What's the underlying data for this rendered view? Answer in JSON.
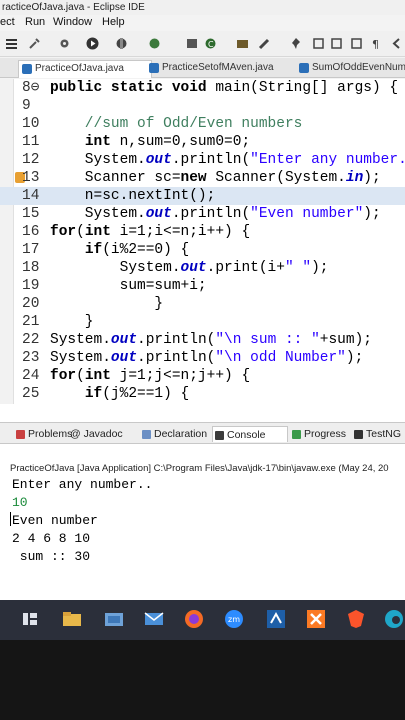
{
  "window": {
    "title": "racticeOfJava.java - Eclipse IDE"
  },
  "menu": [
    "ect",
    "Run",
    "Window",
    "Help"
  ],
  "tabs": [
    {
      "label": "PracticeOfJava.java",
      "active": true
    },
    {
      "label": "PracticeSetofMAven.java",
      "active": false
    },
    {
      "label": "SumOfOddEvenNum",
      "active": false
    }
  ],
  "editor": {
    "lines": [
      {
        "num": "8⊖",
        "code": "public static void main(String[] args) {"
      },
      {
        "num": "9",
        "code": ""
      },
      {
        "num": "10",
        "code": "    //sum of Odd/Even numbers"
      },
      {
        "num": "11",
        "code": "    int n,sum=0,sum0=0;"
      },
      {
        "num": "12",
        "code": "    System.out.println(\"Enter any number..\");"
      },
      {
        "num": "13",
        "code": "    Scanner sc=new Scanner(System.in);"
      },
      {
        "num": "14",
        "code": "    n=sc.nextInt();"
      },
      {
        "num": "15",
        "code": "    System.out.println(\"Even number\");"
      },
      {
        "num": "16",
        "code": "for(int i=1;i<=n;i++) {"
      },
      {
        "num": "17",
        "code": "    if(i%2==0) {"
      },
      {
        "num": "18",
        "code": "        System.out.print(i+\" \");"
      },
      {
        "num": "19",
        "code": "        sum=sum+i;"
      },
      {
        "num": "20",
        "code": "            }"
      },
      {
        "num": "21",
        "code": "    }"
      },
      {
        "num": "22",
        "code": "System.out.println(\"\\n sum :: \"+sum);"
      },
      {
        "num": "23",
        "code": "System.out.println(\"\\n odd Number\");"
      },
      {
        "num": "24",
        "code": "for(int j=1;j<=n;j++) {"
      },
      {
        "num": "25",
        "code": "    if(j%2==1) {"
      }
    ]
  },
  "panel": {
    "tabs": [
      {
        "label": "Problems",
        "color": "#c94040"
      },
      {
        "label": "@ Javadoc",
        "color": ""
      },
      {
        "label": "Declaration",
        "color": "#6b8fc4"
      },
      {
        "label": "Console",
        "color": "#3b3b3b",
        "active": true
      },
      {
        "label": "Progress",
        "color": "#3a9a4a"
      },
      {
        "label": "TestNG",
        "color": "#333333"
      }
    ],
    "console_header": "PracticeOfJava [Java Application] C:\\Program Files\\Java\\jdk-17\\bin\\javaw.exe  (May 24, 20",
    "output": [
      {
        "text": "Enter any number..",
        "input": false
      },
      {
        "text": "10",
        "input": true
      },
      {
        "text": "Even number",
        "input": false
      },
      {
        "text": "2 4 6 8 10",
        "input": false
      },
      {
        "text": " sum :: 30",
        "input": false
      }
    ]
  },
  "taskbar": {
    "apps": [
      "task-view",
      "file-explorer",
      "folder",
      "mail",
      "firefox",
      "zoom",
      "editor",
      "xampp",
      "brave",
      "edge"
    ]
  }
}
